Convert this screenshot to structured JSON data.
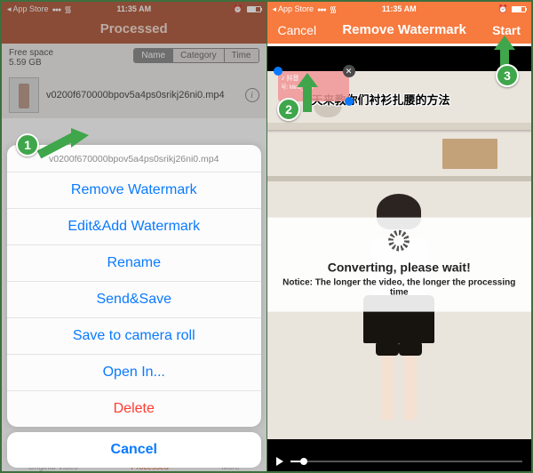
{
  "statusbar": {
    "back": "App Store",
    "time": "11:35 AM"
  },
  "left": {
    "title": "Processed",
    "free_label": "Free space",
    "free_value": "5.59 GB",
    "seg": {
      "name": "Name",
      "category": "Category",
      "time": "Time"
    },
    "filename_row": "v0200f670000bpov5a4ps0srikj26ni0.mp4",
    "sheet": {
      "title": "v0200f670000bpov5a4ps0srikj26ni0.mp4",
      "items": [
        {
          "key": "remove",
          "label": "Remove Watermark"
        },
        {
          "key": "edit",
          "label": "Edit&Add Watermark"
        },
        {
          "key": "rename",
          "label": "Rename"
        },
        {
          "key": "send",
          "label": "Send&Save"
        },
        {
          "key": "roll",
          "label": "Save to camera roll"
        },
        {
          "key": "open",
          "label": "Open In..."
        },
        {
          "key": "delete",
          "label": "Delete"
        }
      ],
      "cancel": "Cancel"
    },
    "tabs": {
      "original": "Original Video",
      "processed": "Processed",
      "more": "More"
    }
  },
  "right": {
    "cancel": "Cancel",
    "title": "Remove Watermark",
    "start": "Start",
    "caption": "天来教你们衬衫扎腰的方法",
    "wm": {
      "app": "抖音",
      "user": "号: Mind_han"
    },
    "convert_title": "Converting, please wait!",
    "convert_notice": "Notice: The longer the video, the longer the processing time"
  },
  "badges": {
    "b1": "1",
    "b2": "2",
    "b3": "3"
  }
}
